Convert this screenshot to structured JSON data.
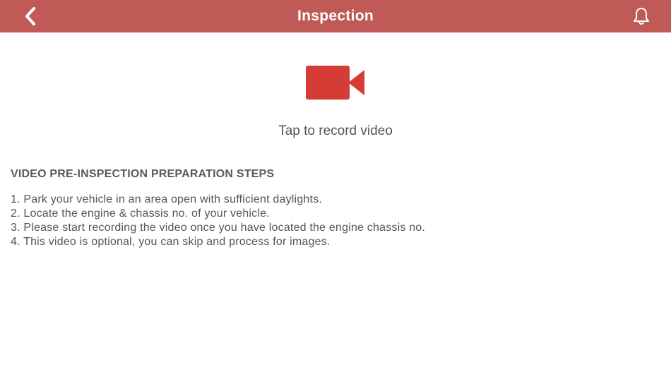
{
  "header": {
    "title": "Inspection",
    "back_icon": "chevron-left-icon",
    "notification_icon": "bell-icon",
    "background_color": "#c05a56"
  },
  "record": {
    "icon": "video-camera-icon",
    "icon_color": "#d43c35",
    "label": "Tap to record video"
  },
  "steps": {
    "heading": "VIDEO PRE-INSPECTION PREPARATION STEPS",
    "items": [
      "1. Park your vehicle in an area open with sufficient daylights.",
      "2. Locate the engine & chassis no. of your vehicle.",
      "3. Please start recording the video once you have located the engine chassis no.",
      "4. This video is optional, you can skip and process for images."
    ]
  }
}
